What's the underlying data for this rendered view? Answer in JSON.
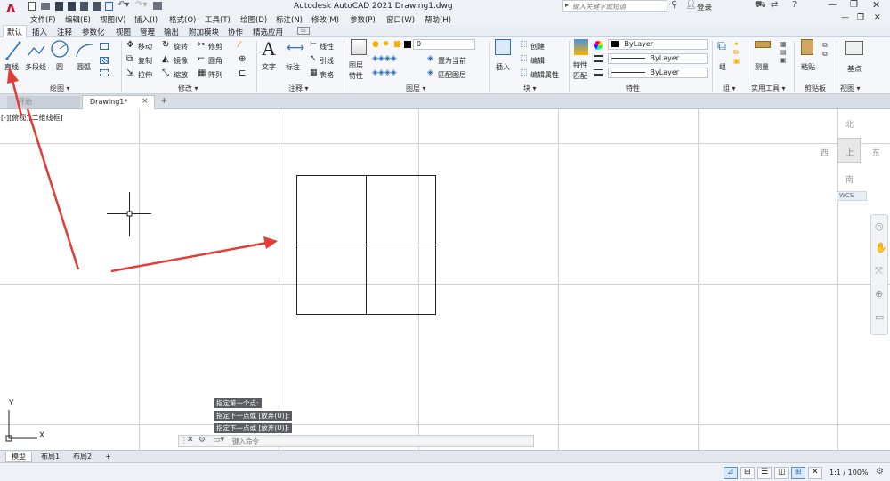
{
  "title": {
    "text": "Autodesk AutoCAD 2021    Drawing1.dwg",
    "search_placeholder": "键入关键字或短语",
    "login": "登录",
    "app_letter": "A"
  },
  "menu": [
    "文件(F)",
    "编辑(E)",
    "视图(V)",
    "插入(I)",
    "格式(O)",
    "工具(T)",
    "绘图(D)",
    "标注(N)",
    "修改(M)",
    "参数(P)",
    "窗口(W)",
    "帮助(H)"
  ],
  "ribbon_tabs": [
    "默认",
    "插入",
    "注释",
    "参数化",
    "视图",
    "管理",
    "输出",
    "附加模块",
    "协作",
    "精选应用"
  ],
  "ribbon": {
    "draw": {
      "title": "绘图 ▾",
      "line": "直线",
      "polyline": "多段线",
      "circle": "圆",
      "arc": "圆弧"
    },
    "modify": {
      "title": "修改 ▾",
      "move": "移动",
      "rotate": "旋转",
      "trim": "修剪",
      "copy": "复制",
      "mirror": "镜像",
      "fillet": "圆角",
      "stretch": "拉伸",
      "scale": "缩放",
      "array": "阵列"
    },
    "annotation": {
      "title": "注释 ▾",
      "text": "文字",
      "dimension": "标注",
      "linear": "线性",
      "leader": "引线",
      "table": "表格"
    },
    "layers": {
      "title": "图层 ▾",
      "layer_props": "图层\n特性",
      "layer_value": "0",
      "set_current": "置为当前",
      "match_layer": "匹配图层"
    },
    "block": {
      "title": "块 ▾",
      "insert": "插入",
      "create": "创建",
      "edit": "编辑",
      "edit_attr": "编辑属性"
    },
    "properties": {
      "title": "特性",
      "match": "特性\n匹配",
      "color": "ByLayer",
      "linetype": "ByLayer",
      "lineweight": "ByLayer"
    },
    "groups": {
      "title": "组 ▾",
      "group": "组"
    },
    "utilities": {
      "title": "实用工具 ▾",
      "measure": "测量"
    },
    "clipboard": {
      "title": "剪贴板",
      "paste": "粘贴"
    },
    "view": {
      "title": "视图 ▾",
      "base": "基点"
    }
  },
  "doc_tabs": {
    "start": "开始",
    "drawing": "Drawing1*",
    "close": "×",
    "add": "+"
  },
  "viewport_label": "[-][俯视][二维线框]",
  "viewcube": {
    "north": "北",
    "south": "南",
    "east": "东",
    "west": "西",
    "top": "上",
    "wcs": "WCS"
  },
  "ucs": {
    "x": "X",
    "y": "Y"
  },
  "command_history": [
    "指定第一个点:",
    "指定下一点或 [放弃(U)]:",
    "指定下一点或 [放弃(U)]:"
  ],
  "command_placeholder": "键入命令",
  "layout_tabs": [
    "模型",
    "布局1",
    "布局2"
  ],
  "layout_add": "+",
  "status": {
    "scale": "1:1 / 100%"
  },
  "colors": {
    "arrow": "#e53b36",
    "app_red": "#c8102e",
    "cmd_bg": "#5a5d62"
  }
}
